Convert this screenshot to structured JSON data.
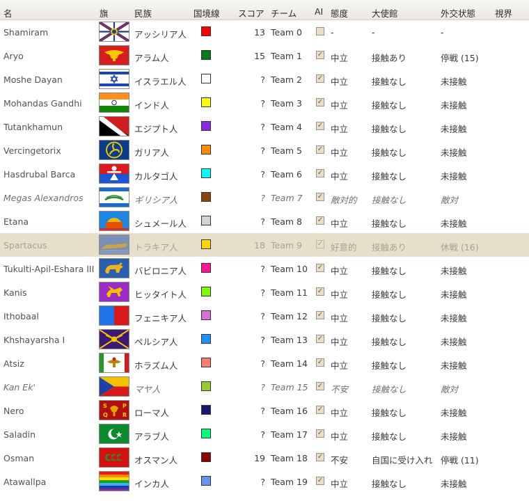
{
  "header": {
    "name": "名",
    "flag": "旗",
    "nation": "民族",
    "border": "国境線",
    "score": "スコア",
    "team": "チーム",
    "ai": "AI",
    "attitude": "態度",
    "embassy": "大使館",
    "diplomacy": "外交状態",
    "vision": "視界"
  },
  "rows": [
    {
      "name": "Shamiram",
      "nation": "アッシリア人",
      "color": "#ff0000",
      "score": "13",
      "team": "Team 0",
      "ai": false,
      "attitude": "-",
      "embassy": "-",
      "diplomacy": "-",
      "flag_icon": "assyria-flag"
    },
    {
      "name": "Aryo",
      "nation": "アラム人",
      "color": "#007a1c",
      "score": "15",
      "team": "Team 1",
      "ai": true,
      "attitude": "中立",
      "embassy": "接触あり",
      "diplomacy": "停戦 (15)",
      "flag_icon": "aram-flag"
    },
    {
      "name": "Moshe Dayan",
      "nation": "イスラエル人",
      "color": "#ffffff",
      "score": "?",
      "team": "Team 2",
      "ai": true,
      "attitude": "中立",
      "embassy": "接触なし",
      "diplomacy": "未接触",
      "flag_icon": "israel-flag"
    },
    {
      "name": "Mohandas Gandhi",
      "nation": "インド人",
      "color": "#ffff00",
      "score": "?",
      "team": "Team 3",
      "ai": true,
      "attitude": "中立",
      "embassy": "接触なし",
      "diplomacy": "未接触",
      "flag_icon": "india-flag"
    },
    {
      "name": "Tutankhamun",
      "nation": "エジプト人",
      "color": "#8a2be2",
      "score": "?",
      "team": "Team 4",
      "ai": true,
      "attitude": "中立",
      "embassy": "接触なし",
      "diplomacy": "未接触",
      "flag_icon": "egypt-flag"
    },
    {
      "name": "Vercingetorix",
      "nation": "ガリア人",
      "color": "#ff8c00",
      "score": "?",
      "team": "Team 5",
      "ai": true,
      "attitude": "中立",
      "embassy": "接触なし",
      "diplomacy": "未接触",
      "flag_icon": "gaul-flag"
    },
    {
      "name": "Hasdrubal Barca",
      "nation": "カルタゴ人",
      "color": "#00ffff",
      "score": "?",
      "team": "Team 6",
      "ai": true,
      "attitude": "中立",
      "embassy": "接触なし",
      "diplomacy": "未接触",
      "flag_icon": "carthage-flag"
    },
    {
      "name": "Megas Alexandros",
      "nation": "ギリシア人",
      "color": "#8b4513",
      "score": "?",
      "team": "Team 7",
      "ai": true,
      "attitude": "敵対的",
      "embassy": "接触なし",
      "diplomacy": "敵対",
      "flag_icon": "greece-flag",
      "italic": true
    },
    {
      "name": "Etana",
      "nation": "シュメール人",
      "color": "#d3d3d3",
      "score": "?",
      "team": "Team 8",
      "ai": true,
      "attitude": "中立",
      "embassy": "接触なし",
      "diplomacy": "未接触",
      "flag_icon": "sumer-flag"
    },
    {
      "name": "Spartacus",
      "nation": "トラキア人",
      "color": "#ffd700",
      "score": "18",
      "team": "Team 9",
      "ai": true,
      "attitude": "好意的",
      "embassy": "接触あり",
      "diplomacy": "休戦 (16)",
      "flag_icon": "thrace-flag",
      "selected": true
    },
    {
      "name": "Tukulti-Apil-Eshara III",
      "nation": "バビロニア人",
      "color": "#ff1493",
      "score": "?",
      "team": "Team 10",
      "ai": true,
      "attitude": "中立",
      "embassy": "接触なし",
      "diplomacy": "未接触",
      "flag_icon": "babylon-flag"
    },
    {
      "name": "Kanis",
      "nation": "ヒッタイト人",
      "color": "#7cfc00",
      "score": "?",
      "team": "Team 11",
      "ai": true,
      "attitude": "中立",
      "embassy": "接触なし",
      "diplomacy": "未接触",
      "flag_icon": "hittite-flag"
    },
    {
      "name": "Ithobaal",
      "nation": "フェニキア人",
      "color": "#da70d6",
      "score": "?",
      "team": "Team 12",
      "ai": true,
      "attitude": "中立",
      "embassy": "接触なし",
      "diplomacy": "未接触",
      "flag_icon": "phoenicia-flag"
    },
    {
      "name": "Khshayarsha I",
      "nation": "ペルシア人",
      "color": "#1e90ff",
      "score": "?",
      "team": "Team 13",
      "ai": true,
      "attitude": "中立",
      "embassy": "接触なし",
      "diplomacy": "未接触",
      "flag_icon": "persia-flag"
    },
    {
      "name": "Atsiz",
      "nation": "ホラズム人",
      "color": "#fa8072",
      "score": "?",
      "team": "Team 14",
      "ai": true,
      "attitude": "中立",
      "embassy": "接触なし",
      "diplomacy": "未接触",
      "flag_icon": "khwarezm-flag"
    },
    {
      "name": "Kan Ek'",
      "nation": "マヤ人",
      "color": "#9acd32",
      "score": "?",
      "team": "Team 15",
      "ai": true,
      "attitude": "不安",
      "embassy": "接触なし",
      "diplomacy": "敵対",
      "flag_icon": "maya-flag",
      "italic": true
    },
    {
      "name": "Nero",
      "nation": "ローマ人",
      "color": "#191970",
      "score": "?",
      "team": "Team 16",
      "ai": true,
      "attitude": "中立",
      "embassy": "接触なし",
      "diplomacy": "未接触",
      "flag_icon": "rome-flag"
    },
    {
      "name": "Saladin",
      "nation": "アラブ人",
      "color": "#00ff7f",
      "score": "?",
      "team": "Team 17",
      "ai": true,
      "attitude": "中立",
      "embassy": "接触なし",
      "diplomacy": "未接触",
      "flag_icon": "arab-flag"
    },
    {
      "name": "Osman",
      "nation": "オスマン人",
      "color": "#8b0000",
      "score": "19",
      "team": "Team 18",
      "ai": true,
      "attitude": "不安",
      "embassy": "自国に受け入れ",
      "diplomacy": "停戦 (11)",
      "flag_icon": "ottoman-flag"
    },
    {
      "name": "Atawallpa",
      "nation": "インカ人",
      "color": "#6495ed",
      "score": "?",
      "team": "Team 19",
      "ai": true,
      "attitude": "中立",
      "embassy": "接触なし",
      "diplomacy": "未接触",
      "flag_icon": "inca-flag"
    }
  ],
  "flag_letters": {
    "rome": [
      "S",
      "P",
      "Q",
      "R"
    ]
  }
}
